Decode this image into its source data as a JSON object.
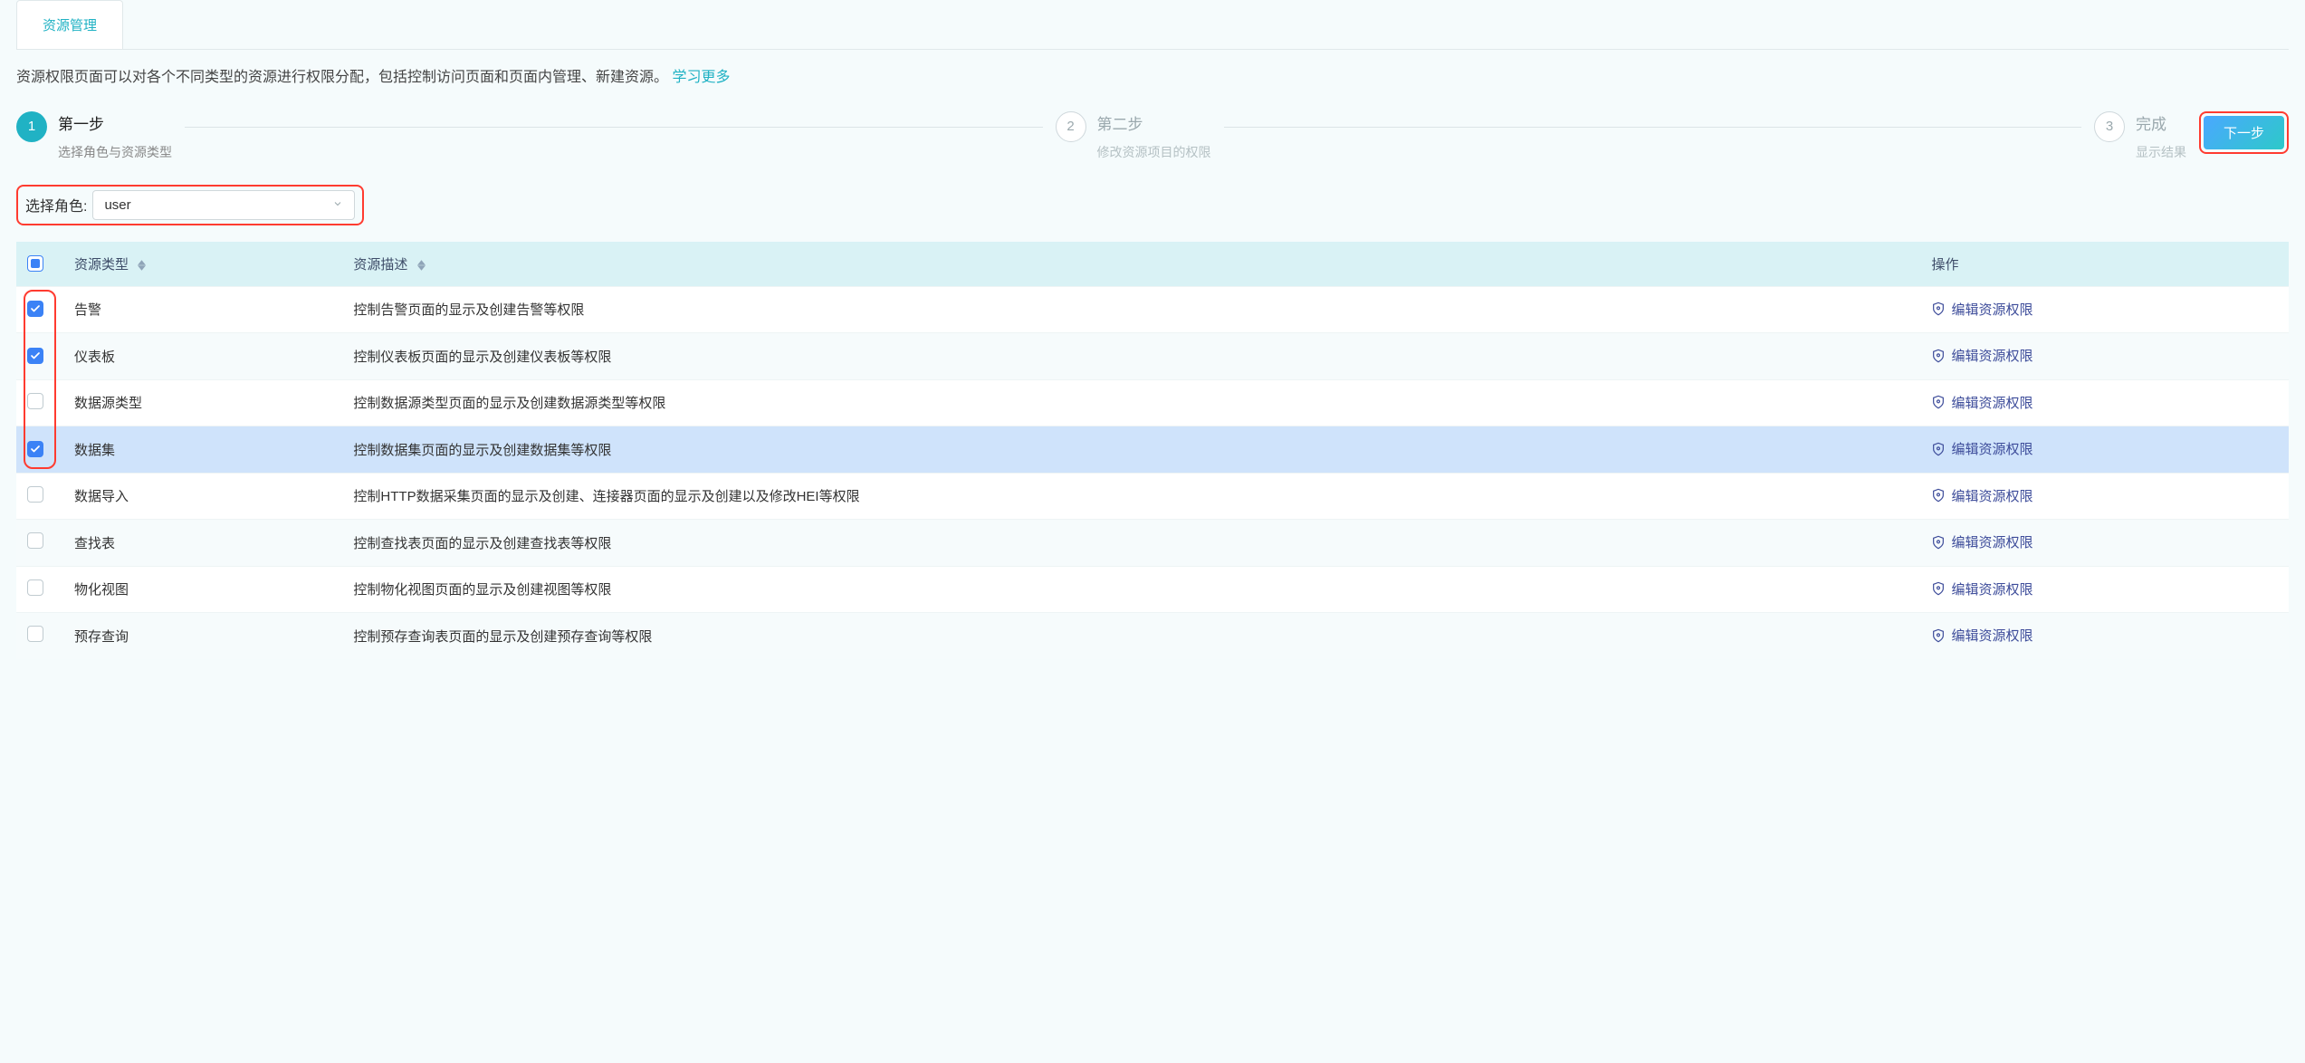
{
  "tabs": {
    "resource_mgmt": "资源管理"
  },
  "description": {
    "text": "资源权限页面可以对各个不同类型的资源进行权限分配，包括控制访问页面和页面内管理、新建资源。",
    "link": "学习更多"
  },
  "steps": [
    {
      "num": "1",
      "title": "第一步",
      "sub": "选择角色与资源类型",
      "active": true
    },
    {
      "num": "2",
      "title": "第二步",
      "sub": "修改资源项目的权限",
      "active": false
    },
    {
      "num": "3",
      "title": "完成",
      "sub": "显示结果",
      "active": false
    }
  ],
  "next_button": "下一步",
  "role": {
    "label": "选择角色:",
    "value": "user"
  },
  "table": {
    "header": {
      "type": "资源类型",
      "desc": "资源描述",
      "action": "操作"
    },
    "action_label": "编辑资源权限",
    "rows": [
      {
        "checked": true,
        "selected": false,
        "type": "告警",
        "desc": "控制告警页面的显示及创建告警等权限"
      },
      {
        "checked": true,
        "selected": false,
        "type": "仪表板",
        "desc": "控制仪表板页面的显示及创建仪表板等权限"
      },
      {
        "checked": false,
        "selected": false,
        "type": "数据源类型",
        "desc": "控制数据源类型页面的显示及创建数据源类型等权限"
      },
      {
        "checked": true,
        "selected": true,
        "type": "数据集",
        "desc": "控制数据集页面的显示及创建数据集等权限"
      },
      {
        "checked": false,
        "selected": false,
        "type": "数据导入",
        "desc": "控制HTTP数据采集页面的显示及创建、连接器页面的显示及创建以及修改HEI等权限"
      },
      {
        "checked": false,
        "selected": false,
        "type": "查找表",
        "desc": "控制查找表页面的显示及创建查找表等权限"
      },
      {
        "checked": false,
        "selected": false,
        "type": "物化视图",
        "desc": "控制物化视图页面的显示及创建视图等权限"
      },
      {
        "checked": false,
        "selected": false,
        "type": "预存查询",
        "desc": "控制预存查询表页面的显示及创建预存查询等权限"
      }
    ]
  }
}
